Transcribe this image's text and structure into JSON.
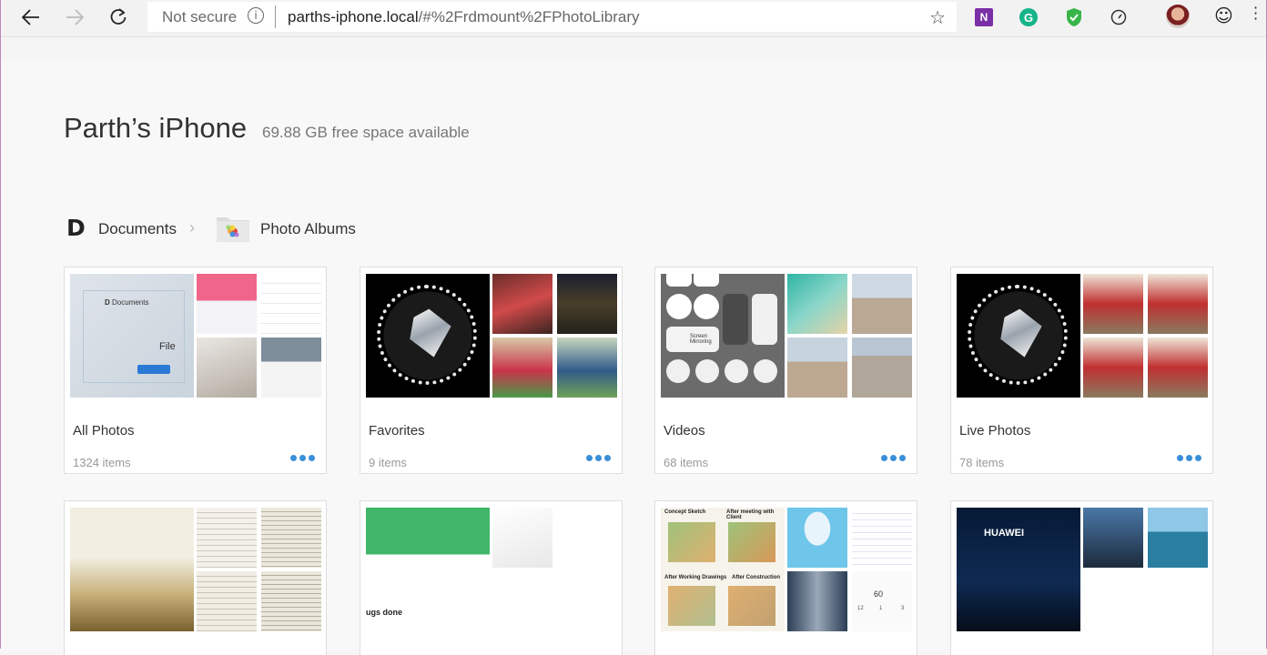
{
  "browser": {
    "security_label": "Not secure",
    "url_host": "parths-iphone.local",
    "url_path": "/#%2Frdmount%2FPhotoLibrary"
  },
  "header": {
    "device_name": "Parth’s iPhone",
    "free_space": "69.88 GB free space available"
  },
  "breadcrumb": {
    "documents_label": "Documents",
    "photo_albums_label": "Photo Albums"
  },
  "albums": [
    {
      "name": "All Photos",
      "count": "1324 items"
    },
    {
      "name": "Favorites",
      "count": "9 items"
    },
    {
      "name": "Videos",
      "count": "68 items"
    },
    {
      "name": "Live Photos",
      "count": "78 items"
    }
  ],
  "thumbnail_text": {
    "documents_app": "Documents",
    "file_label": "File",
    "screen_mirroring": "Screen Mirroring",
    "tasks": "ugs done",
    "concept_sketch": "Concept Sketch",
    "after_meeting": "After meeting with Client",
    "after_drawings": "After Working Drawings",
    "after_construction": "After Construction",
    "huawei": "HUAWEI",
    "stat_value": "60",
    "stat_ticks": [
      "12",
      "1",
      "3"
    ]
  }
}
